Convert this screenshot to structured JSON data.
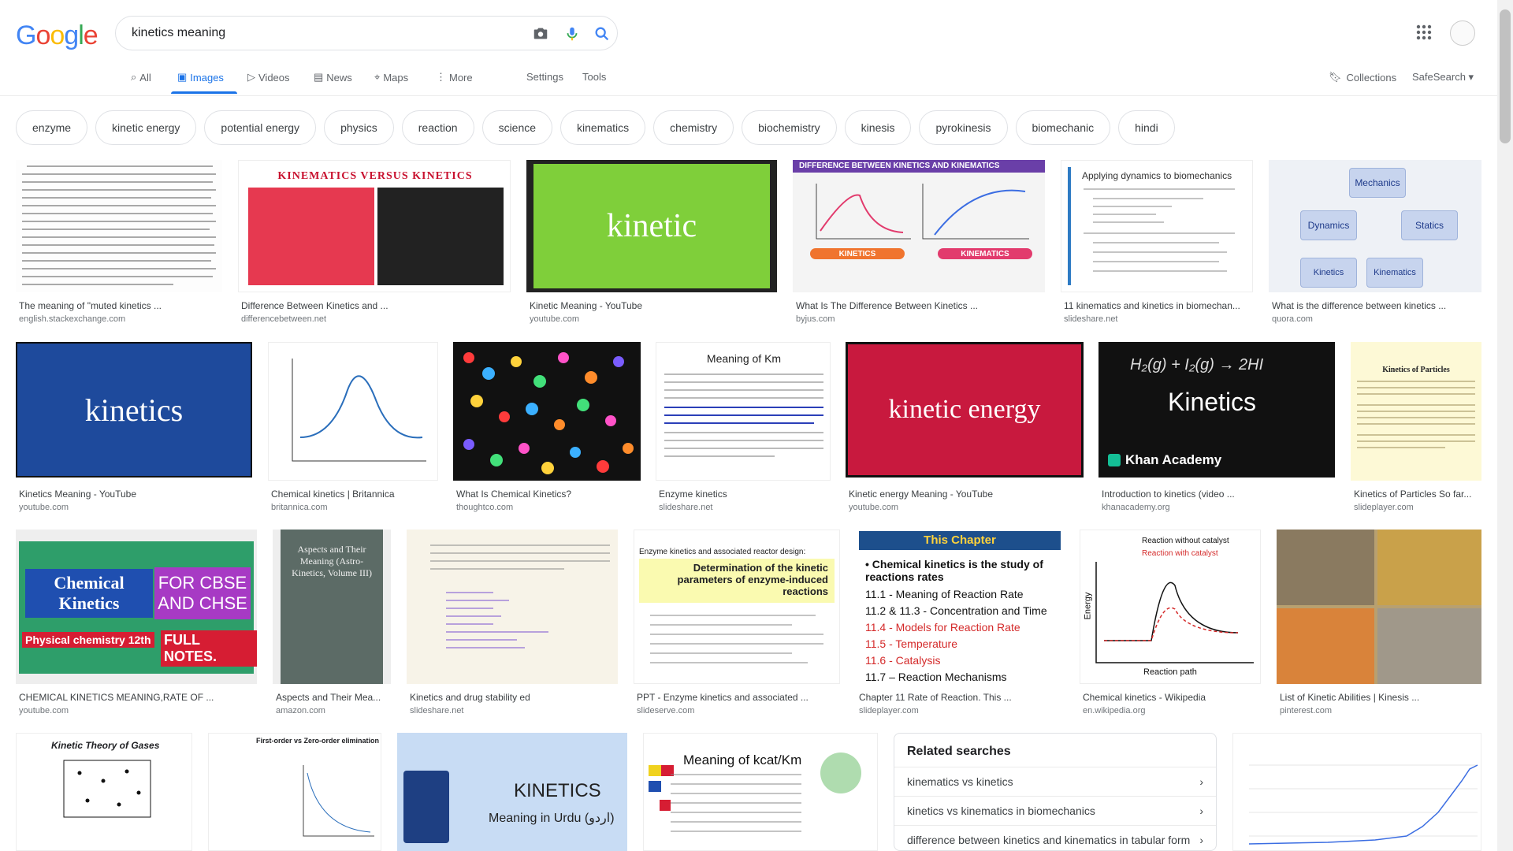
{
  "search": {
    "query": "kinetics meaning"
  },
  "nav": {
    "all": "All",
    "images": "Images",
    "videos": "Videos",
    "news": "News",
    "maps": "Maps",
    "more": "More",
    "settings": "Settings",
    "tools": "Tools",
    "collections": "Collections",
    "safesearch": "SafeSearch ▾"
  },
  "chips": [
    "enzyme",
    "kinetic energy",
    "potential energy",
    "physics",
    "reaction",
    "science",
    "kinematics",
    "chemistry",
    "biochemistry",
    "kinesis",
    "pyrokinesis",
    "biomechanic",
    "hindi"
  ],
  "results": [
    {
      "caption": "The meaning of \"muted kinetics ...",
      "source": "english.stackexchange.com"
    },
    {
      "caption": "Difference Between Kinetics and ...",
      "source": "differencebetween.net"
    },
    {
      "caption": "Kinetic Meaning - YouTube",
      "source": "youtube.com"
    },
    {
      "caption": "What Is The Difference Between Kinetics ...",
      "source": "byjus.com"
    },
    {
      "caption": "11 kinematics and kinetics in biomechan...",
      "source": "slideshare.net"
    },
    {
      "caption": "What is the difference between kinetics ...",
      "source": "quora.com"
    },
    {
      "caption": "Kinetics Meaning - YouTube",
      "source": "youtube.com"
    },
    {
      "caption": "Chemical kinetics | Britannica",
      "source": "britannica.com"
    },
    {
      "caption": "What Is Chemical Kinetics?",
      "source": "thoughtco.com"
    },
    {
      "caption": "Enzyme kinetics",
      "source": "slideshare.net"
    },
    {
      "caption": "Kinetic energy Meaning - YouTube",
      "source": "youtube.com"
    },
    {
      "caption": "Introduction to kinetics (video ...",
      "source": "khanacademy.org"
    },
    {
      "caption": "Kinetics of Particles So far...",
      "source": "slideplayer.com"
    },
    {
      "caption": "CHEMICAL KINETICS MEANING,RATE OF ...",
      "source": "youtube.com"
    },
    {
      "caption": "Aspects and Their Mea...",
      "source": "amazon.com"
    },
    {
      "caption": "Kinetics and drug stability ed",
      "source": "slideshare.net"
    },
    {
      "caption": "PPT - Enzyme kinetics and associated ...",
      "source": "slideserve.com"
    },
    {
      "caption": "Chapter 11 Rate of Reaction. This ...",
      "source": "slideplayer.com"
    },
    {
      "caption": "Chemical kinetics - Wikipedia",
      "source": "en.wikipedia.org"
    },
    {
      "caption": "List of Kinetic Abilities | Kinesis ...",
      "source": "pinterest.com"
    }
  ],
  "thumb_text": {
    "kinetic": "kinetic",
    "kinetics": "kinetics",
    "kinetic_energy": "kinetic energy",
    "khan_title": "Kinetics",
    "khan_brand": "Khan Academy",
    "khan_eq": "H₂(g) + I₂(g) → 2HI",
    "kinematics_versus": "KINEMATICS  VERSUS  KINETICS",
    "diff_kin_kine": "DIFFERENCE BETWEEN KINETICS AND KINEMATICS",
    "byjus_kinetics": "KINETICS",
    "byjus_kinematics": "KINEMATICS",
    "biomech_title": "Applying dynamics to biomechanics",
    "quora_mechanics": "Mechanics",
    "quora_dynamics": "Dynamics",
    "quora_statics": "Statics",
    "quora_kinetics": "Kinetics",
    "quora_kinematics": "Kinematics",
    "enzyme_title": "Meaning of Km",
    "kin_particles": "Kinetics of Particles",
    "chem_kin_left": "Chemical Kinetics",
    "chem_kin_right": "FOR CBSE AND CHSE",
    "chem_kin_bottom1": "Physical chemistry 12th",
    "chem_kin_bottom2": "FULL NOTES.",
    "aspects": "Aspects and Their Meaning (Astro-Kinetics, Volume III)",
    "chapter_title": "This Chapter",
    "chapter_lines": [
      "• Chemical kinetics is the study of reactions rates",
      "11.1 - Meaning of Reaction Rate",
      "11.2 & 11.3 - Concentration and Time",
      "11.4 - Models for Reaction Rate",
      "11.5 - Temperature",
      "11.6 - Catalysis",
      "11.7 – Reaction Mechanisms"
    ],
    "wiki_l1": "Reaction without catalyst",
    "wiki_l2": "Reaction with catalyst",
    "wiki_x": "Reaction path",
    "wiki_y": "Energy",
    "enzyme_reactor_title": "Enzyme kinetics and associated reactor design:",
    "enzyme_reactor_box": "Determination of the kinetic parameters of enzyme-induced reactions",
    "gases_title": "Kinetic Theory of Gases",
    "urdu_kinetics": "KINETICS",
    "urdu_meaning": "Meaning in Urdu (اردو)",
    "kcat_title": "Meaning of kcat/Km",
    "order_title": "First-order vs Zero-order elimination"
  },
  "related": {
    "heading": "Related searches",
    "items": [
      "kinematics vs kinetics",
      "kinetics vs kinematics in biomechanics",
      "difference between kinetics and kinematics in tabular form"
    ]
  },
  "colors": {
    "accent": "#1a73e8",
    "youtube_green": "#7fcf3a",
    "youtube_blue": "#1e4a9c",
    "youtube_red": "#c8193e"
  }
}
